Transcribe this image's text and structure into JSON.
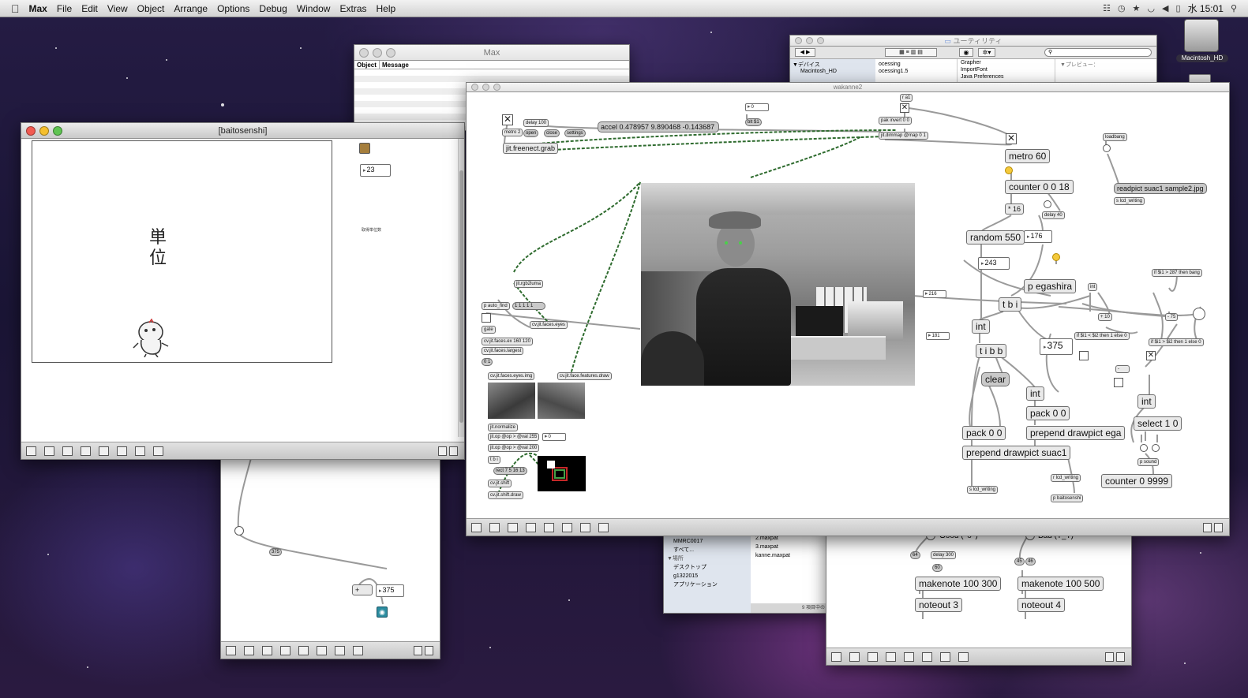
{
  "menubar": {
    "app": "Max",
    "items": [
      "File",
      "Edit",
      "View",
      "Object",
      "Arrange",
      "Options",
      "Debug",
      "Window",
      "Extras",
      "Help"
    ],
    "clock": "水 15:01"
  },
  "desktop": {
    "hd_label": "Macintosh_HD"
  },
  "max_window": {
    "title": "Max",
    "col_object": "Object",
    "col_message": "Message"
  },
  "finder_window": {
    "title": "ユーティリティ",
    "sidebar_devices": "▼デバイス",
    "sidebar_hd": "Macintosh_HD",
    "col1": [
      "ocessing",
      "ocessing1.5"
    ],
    "col2": [
      "Grapher",
      "ImportFont",
      "Java Preferences"
    ],
    "preview": "▼プレビュー："
  },
  "finder_window2": {
    "items": [
      "MMRC0017",
      "すべて..."
    ],
    "places_header": "▼場所",
    "places": [
      "デスクトップ",
      "g1322015",
      "アプリケーション"
    ],
    "files": [
      "2.maxpat",
      "3.maxpat",
      "kanne.maxpat"
    ],
    "status": "9 項目中の"
  },
  "baitosenshi": {
    "title": "[baitosenshi]",
    "big_text_1": "単",
    "big_text_2": "位",
    "num": "23",
    "small_label": "取得単位数"
  },
  "sub_patch": {
    "num_375_a": "375",
    "plus": "+",
    "num_375_b": "375"
  },
  "wakanne": {
    "title": "wakanne2",
    "objects": {
      "delay100": "delay 100",
      "metro2": "metro 2",
      "open": "open",
      "close": "close",
      "settings": "settings",
      "accel": "accel 0.478957 9.890468 -0.143687",
      "freenect": "jit.freenect.grab",
      "num0": "0",
      "blt": "blt $1",
      "ra1": "r a1",
      "pakinvert": "pak invert 0 0",
      "dimmap": "jit.dimmap @map 0 1",
      "metro60": "metro 60",
      "loadbang": "loadbang",
      "counter018": "counter 0 0 18",
      "readpict": "readpict suac1 sample2.jpg",
      "slcd": "s lcd_writing",
      "mul16": "* 16",
      "delay40": "delay 40",
      "random550": "random 550",
      "num176": "176",
      "num243": "243",
      "pegashira": "p egashira",
      "int_small": "int",
      "if287": "if $i1 > 287 then bang",
      "num216": "216",
      "tbi": "t b i",
      "plus10": "+ 10",
      "minus75": "- 75",
      "int1": "int",
      "iflt": "if $i1 < $i2 then 1 else 0",
      "ifgt": "if $i1 > $i2 then 1 else 0",
      "num181": "181",
      "num375": "375",
      "tibb": "t i b b",
      "minus": "-",
      "clear": "clear",
      "int2": "int",
      "int3": "int",
      "pack00a": "pack 0 0",
      "select10": "select 1 0",
      "pack00b": "pack 0 0",
      "prependega": "prepend drawpict ega",
      "prependsuac": "prepend drawpict suac1",
      "psound": "p sound",
      "rlcd": "r lcd_writing",
      "counter09999": "counter 0 9999",
      "slcd2": "s lcd_writing",
      "pbaito": "p baitosenshi",
      "rgb2luma": "jit.rgb2luma",
      "pautofind": "p auto_find",
      "num11111": "1 1 1 1 1",
      "gate": "gate",
      "faceseyes": "cv.jit.faces.eyes",
      "facesex": "cv.jit.faces.ex 160 120",
      "faceslargest": "cv.jit.faces.largest",
      "num01": "0 1",
      "eyesimg": "cv.jit.faces.eyes.img",
      "featuresdraw": "cv.jit.face.features.draw",
      "normalize": "jit.normalize",
      "op255": "jit.op @op > @val 255",
      "op200": "jit.op @op > @val 200",
      "num0b": "0",
      "tbi2": "t b i",
      "rect": "rect 7 5 16 13",
      "shift": "cv.jit.shift",
      "shiftdraw": "cv.jit.shift.draw"
    }
  },
  "bottom_patch": {
    "good": "Good (^o^)",
    "bad": "Bad (T_T)",
    "num64": "64",
    "delay300": "delay 300",
    "num60": "60",
    "num45": "45",
    "num46": "46",
    "makenote1": "makenote 100 300",
    "makenote2": "makenote 100 500",
    "noteout3": "noteout 3",
    "noteout4": "noteout 4"
  },
  "colors": {
    "cord_green": "#2e6b2e",
    "cord_gray": "#9a9a9a",
    "bang_lit": "#f4c93c"
  }
}
